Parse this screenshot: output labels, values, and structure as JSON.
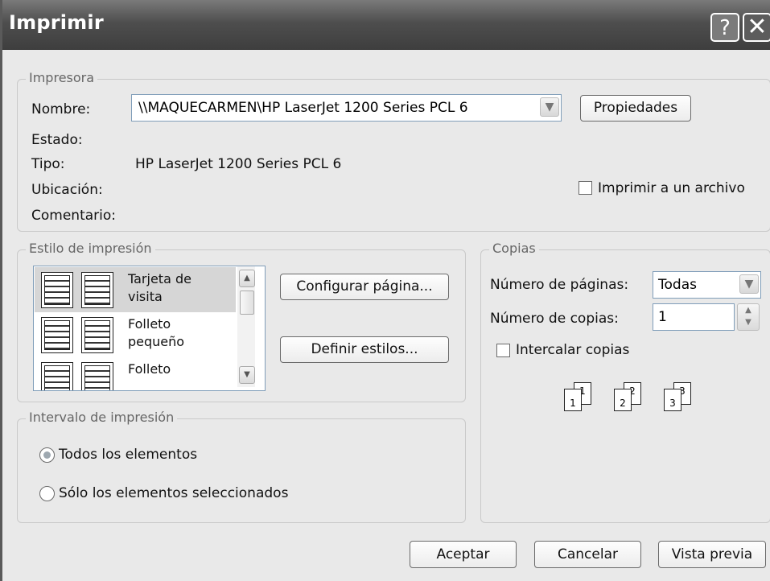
{
  "window": {
    "title": "Imprimir"
  },
  "printer": {
    "legend": "Impresora",
    "name_label": "Nombre:",
    "name_value": "\\\\MAQUECARMEN\\HP LaserJet 1200 Series PCL 6",
    "properties_button": "Propiedades",
    "status_label": "Estado:",
    "status_value": "",
    "type_label": "Tipo:",
    "type_value": "HP LaserJet 1200 Series PCL 6",
    "location_label": "Ubicación:",
    "comment_label": "Comentario:",
    "print_to_file_label": "Imprimir a un archivo"
  },
  "print_style": {
    "legend": "Estilo de impresión",
    "items": [
      {
        "line1": "Tarjeta de",
        "line2": "visita",
        "selected": true
      },
      {
        "line1": "Folleto",
        "line2": "pequeño",
        "selected": false
      },
      {
        "line1": "Folleto",
        "line2": "",
        "selected": false
      }
    ],
    "page_setup_button": "Configurar página...",
    "define_styles_button": "Definir estilos..."
  },
  "copies": {
    "legend": "Copias",
    "pages_label": "Número de páginas:",
    "pages_value": "Todas",
    "copies_label": "Número de copias:",
    "copies_value": "1",
    "collate_label": "Intercalar copias",
    "collate_pages": [
      "1",
      "1",
      "2",
      "2",
      "3",
      "3"
    ]
  },
  "print_range": {
    "legend": "Intervalo de impresión",
    "all_items": "Todos los elementos",
    "selected_items": "Sólo los elementos seleccionados"
  },
  "footer": {
    "ok": "Aceptar",
    "cancel": "Cancelar",
    "preview": "Vista previa"
  },
  "colors": {
    "titlebar": "#4e4e4e",
    "dialog_bg": "#e9e9e9",
    "selection": "#d6d6d6"
  }
}
